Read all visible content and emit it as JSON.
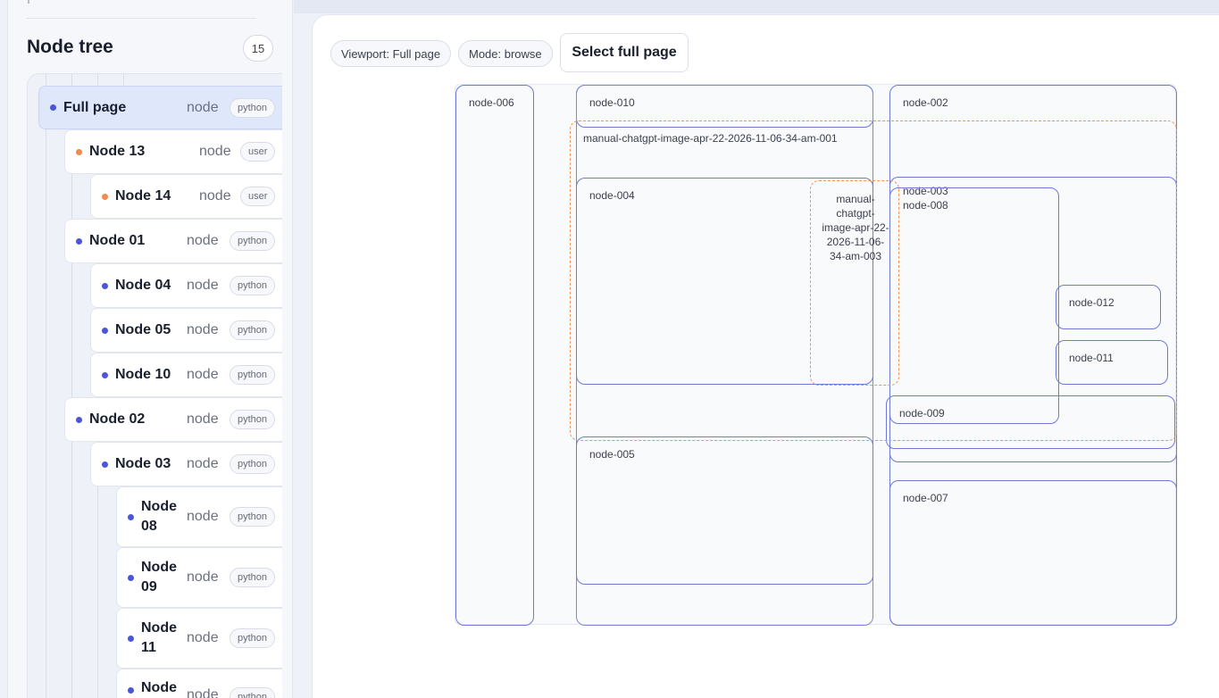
{
  "sidebar": {
    "title": "Node tree",
    "count": "15",
    "items": [
      {
        "label": "Full page",
        "type": "node",
        "tag": "python",
        "kind": "python"
      },
      {
        "label": "Node 13",
        "type": "node",
        "tag": "user",
        "kind": "user"
      },
      {
        "label": "Node 14",
        "type": "node",
        "tag": "user",
        "kind": "user"
      },
      {
        "label": "Node 01",
        "type": "node",
        "tag": "python",
        "kind": "python"
      },
      {
        "label": "Node 04",
        "type": "node",
        "tag": "python",
        "kind": "python"
      },
      {
        "label": "Node 05",
        "type": "node",
        "tag": "python",
        "kind": "python"
      },
      {
        "label": "Node 10",
        "type": "node",
        "tag": "python",
        "kind": "python"
      },
      {
        "label": "Node 02",
        "type": "node",
        "tag": "python",
        "kind": "python"
      },
      {
        "label": "Node 03",
        "type": "node",
        "tag": "python",
        "kind": "python"
      },
      {
        "label": "Node 08",
        "type": "node",
        "tag": "python",
        "kind": "python"
      },
      {
        "label": "Node 09",
        "type": "node",
        "tag": "python",
        "kind": "python"
      },
      {
        "label": "Node 11",
        "type": "node",
        "tag": "python",
        "kind": "python"
      },
      {
        "label": "Node",
        "type": "node",
        "tag": "python",
        "kind": "python"
      }
    ]
  },
  "toolbar": {
    "viewport": "Viewport: Full page",
    "mode": "Mode: browse",
    "select_full_page": "Select full page"
  },
  "canvas": {
    "boxes": {
      "n006": "node-006",
      "n010": "node-010",
      "n002": "node-002",
      "n004": "node-004",
      "n003": "node-003",
      "n008": "node-008",
      "n012": "node-012",
      "n011": "node-011",
      "n009": "node-009",
      "n005": "node-005",
      "n007": "node-007"
    },
    "manual": {
      "m001": "manual-chatgpt-image-apr-22-2026-11-06-34-am-001",
      "m003": "manual-chatgpt-image-apr-22-2026-11-06-34-am-003"
    }
  },
  "colors": {
    "accent": "#4a56d6",
    "box_border": "#6f79d8",
    "manual_border": "#f0945a",
    "user_dot": "#f28a4c",
    "selected_bg": "#dfe7fb"
  }
}
